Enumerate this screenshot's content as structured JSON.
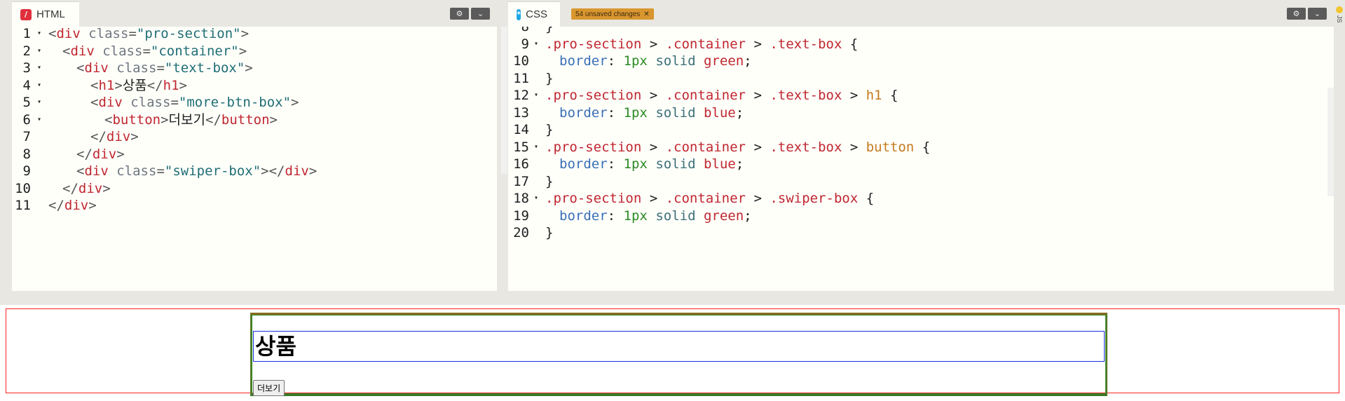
{
  "html_pane": {
    "tab_label": "HTML",
    "tab_icon": "slash-icon",
    "lines": [
      {
        "n": "1",
        "fold": true,
        "parts": [
          [
            "c-punc",
            "<"
          ],
          [
            "c-tag",
            "div"
          ],
          [
            "c-plain",
            " "
          ],
          [
            "c-attr",
            "class"
          ],
          [
            "c-punc",
            "="
          ],
          [
            "c-str",
            "\"pro-section\""
          ],
          [
            "c-punc",
            ">"
          ]
        ],
        "indent": 0
      },
      {
        "n": "2",
        "fold": true,
        "parts": [
          [
            "c-punc",
            "<"
          ],
          [
            "c-tag",
            "div"
          ],
          [
            "c-plain",
            " "
          ],
          [
            "c-attr",
            "class"
          ],
          [
            "c-punc",
            "="
          ],
          [
            "c-str",
            "\"container\""
          ],
          [
            "c-punc",
            ">"
          ]
        ],
        "indent": 1
      },
      {
        "n": "3",
        "fold": true,
        "parts": [
          [
            "c-punc",
            "<"
          ],
          [
            "c-tag",
            "div"
          ],
          [
            "c-plain",
            " "
          ],
          [
            "c-attr",
            "class"
          ],
          [
            "c-punc",
            "="
          ],
          [
            "c-str",
            "\"text-box\""
          ],
          [
            "c-punc",
            ">"
          ]
        ],
        "indent": 2
      },
      {
        "n": "4",
        "fold": true,
        "parts": [
          [
            "c-punc",
            "<"
          ],
          [
            "c-tag",
            "h1"
          ],
          [
            "c-punc",
            ">"
          ],
          [
            "c-plain",
            "상품"
          ],
          [
            "c-punc",
            "</"
          ],
          [
            "c-tag",
            "h1"
          ],
          [
            "c-punc",
            ">"
          ]
        ],
        "indent": 3
      },
      {
        "n": "5",
        "fold": true,
        "parts": [
          [
            "c-punc",
            "<"
          ],
          [
            "c-tag",
            "div"
          ],
          [
            "c-plain",
            " "
          ],
          [
            "c-attr",
            "class"
          ],
          [
            "c-punc",
            "="
          ],
          [
            "c-str",
            "\"more-btn-box\""
          ],
          [
            "c-punc",
            ">"
          ]
        ],
        "indent": 3
      },
      {
        "n": "6",
        "fold": true,
        "parts": [
          [
            "c-punc",
            "<"
          ],
          [
            "c-tag",
            "button"
          ],
          [
            "c-punc",
            ">"
          ],
          [
            "c-plain",
            "더보기"
          ],
          [
            "c-punc",
            "</"
          ],
          [
            "c-tag",
            "button"
          ],
          [
            "c-punc",
            ">"
          ]
        ],
        "indent": 4
      },
      {
        "n": "7",
        "fold": false,
        "parts": [
          [
            "c-punc",
            "</"
          ],
          [
            "c-tag",
            "div"
          ],
          [
            "c-punc",
            ">"
          ]
        ],
        "indent": 3
      },
      {
        "n": "8",
        "fold": false,
        "parts": [
          [
            "c-punc",
            "</"
          ],
          [
            "c-tag",
            "div"
          ],
          [
            "c-punc",
            ">"
          ]
        ],
        "indent": 2
      },
      {
        "n": "9",
        "fold": false,
        "parts": [
          [
            "c-punc",
            "<"
          ],
          [
            "c-tag",
            "div"
          ],
          [
            "c-plain",
            " "
          ],
          [
            "c-attr",
            "class"
          ],
          [
            "c-punc",
            "="
          ],
          [
            "c-str",
            "\"swiper-box\""
          ],
          [
            "c-punc",
            "></"
          ],
          [
            "c-tag",
            "div"
          ],
          [
            "c-punc",
            ">"
          ]
        ],
        "indent": 2
      },
      {
        "n": "10",
        "fold": false,
        "parts": [
          [
            "c-punc",
            "</"
          ],
          [
            "c-tag",
            "div"
          ],
          [
            "c-punc",
            ">"
          ]
        ],
        "indent": 1
      },
      {
        "n": "11",
        "fold": false,
        "parts": [
          [
            "c-punc",
            "</"
          ],
          [
            "c-tag",
            "div"
          ],
          [
            "c-punc",
            ">"
          ]
        ],
        "indent": 0
      }
    ]
  },
  "css_pane": {
    "tab_label": "CSS",
    "tab_icon": "asterisk-icon",
    "unsaved_badge": "54 unsaved changes",
    "lines": [
      {
        "n": "8",
        "fold": false,
        "parts": [
          [
            "c-plain",
            "}"
          ]
        ],
        "indent": 0
      },
      {
        "n": "9",
        "fold": true,
        "parts": [
          [
            "c-sel",
            ".pro-section"
          ],
          [
            "c-plain",
            " > "
          ],
          [
            "c-sel",
            ".container"
          ],
          [
            "c-plain",
            " > "
          ],
          [
            "c-sel",
            ".text-box"
          ],
          [
            "c-plain",
            " {"
          ]
        ],
        "indent": 0
      },
      {
        "n": "10",
        "fold": false,
        "parts": [
          [
            "c-prop",
            "border"
          ],
          [
            "c-plain",
            ": "
          ],
          [
            "c-num",
            "1px"
          ],
          [
            "c-plain",
            " "
          ],
          [
            "c-kw",
            "solid"
          ],
          [
            "c-plain",
            " "
          ],
          [
            "c-sel",
            "green"
          ],
          [
            "c-plain",
            ";"
          ]
        ],
        "indent": 1
      },
      {
        "n": "11",
        "fold": false,
        "parts": [
          [
            "c-plain",
            "}"
          ]
        ],
        "indent": 0
      },
      {
        "n": "12",
        "fold": true,
        "parts": [
          [
            "c-sel",
            ".pro-section"
          ],
          [
            "c-plain",
            " > "
          ],
          [
            "c-sel",
            ".container"
          ],
          [
            "c-plain",
            " > "
          ],
          [
            "c-sel",
            ".text-box"
          ],
          [
            "c-plain",
            " > "
          ],
          [
            "c-el",
            "h1"
          ],
          [
            "c-plain",
            " {"
          ]
        ],
        "indent": 0
      },
      {
        "n": "13",
        "fold": false,
        "parts": [
          [
            "c-prop",
            "border"
          ],
          [
            "c-plain",
            ": "
          ],
          [
            "c-num",
            "1px"
          ],
          [
            "c-plain",
            " "
          ],
          [
            "c-kw",
            "solid"
          ],
          [
            "c-plain",
            " "
          ],
          [
            "c-sel",
            "blue"
          ],
          [
            "c-plain",
            ";"
          ]
        ],
        "indent": 1
      },
      {
        "n": "14",
        "fold": false,
        "parts": [
          [
            "c-plain",
            "}"
          ]
        ],
        "indent": 0
      },
      {
        "n": "15",
        "fold": true,
        "parts": [
          [
            "c-sel",
            ".pro-section"
          ],
          [
            "c-plain",
            " > "
          ],
          [
            "c-sel",
            ".container"
          ],
          [
            "c-plain",
            " > "
          ],
          [
            "c-sel",
            ".text-box"
          ],
          [
            "c-plain",
            " > "
          ],
          [
            "c-el",
            "button"
          ],
          [
            "c-plain",
            " {"
          ]
        ],
        "indent": 0
      },
      {
        "n": "16",
        "fold": false,
        "parts": [
          [
            "c-prop",
            "border"
          ],
          [
            "c-plain",
            ": "
          ],
          [
            "c-num",
            "1px"
          ],
          [
            "c-plain",
            " "
          ],
          [
            "c-kw",
            "solid"
          ],
          [
            "c-plain",
            " "
          ],
          [
            "c-sel",
            "blue"
          ],
          [
            "c-plain",
            ";"
          ]
        ],
        "indent": 1
      },
      {
        "n": "17",
        "fold": false,
        "parts": [
          [
            "c-plain",
            "}"
          ]
        ],
        "indent": 0
      },
      {
        "n": "18",
        "fold": true,
        "parts": [
          [
            "c-sel",
            ".pro-section"
          ],
          [
            "c-plain",
            " > "
          ],
          [
            "c-sel",
            ".container"
          ],
          [
            "c-plain",
            " > "
          ],
          [
            "c-sel",
            ".swiper-box"
          ],
          [
            "c-plain",
            " {"
          ]
        ],
        "indent": 0
      },
      {
        "n": "19",
        "fold": false,
        "parts": [
          [
            "c-prop",
            "border"
          ],
          [
            "c-plain",
            ": "
          ],
          [
            "c-num",
            "1px"
          ],
          [
            "c-plain",
            " "
          ],
          [
            "c-kw",
            "solid"
          ],
          [
            "c-plain",
            " "
          ],
          [
            "c-sel",
            "green"
          ],
          [
            "c-plain",
            ";"
          ]
        ],
        "indent": 1
      },
      {
        "n": "20",
        "fold": false,
        "parts": [
          [
            "c-plain",
            "}"
          ]
        ],
        "indent": 0
      }
    ]
  },
  "header_buttons": {
    "settings_icon": "gear-icon",
    "collapse_icon": "chevron-down-icon"
  },
  "js_strip": {
    "label": "JS"
  },
  "preview": {
    "heading": "상품",
    "button_label": "더보기"
  },
  "colors": {
    "section_border": "#ff2020",
    "text_box_border": "#2a8a22",
    "h1_border": "#1a2ee0",
    "badge": "#d9962f"
  }
}
